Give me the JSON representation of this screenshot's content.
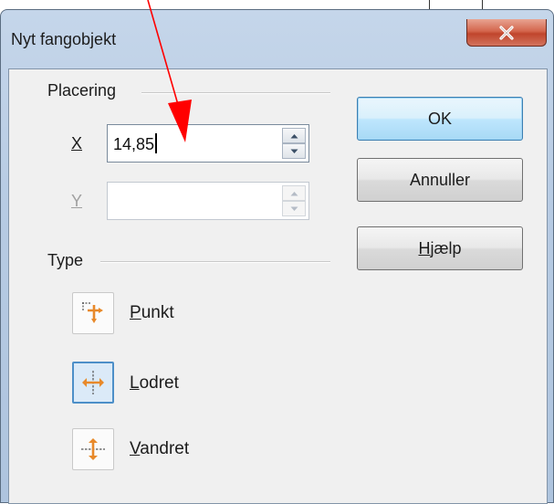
{
  "window": {
    "title": "Nyt fangobjekt",
    "close_icon": "close-x-icon"
  },
  "placement": {
    "group_label": "Placering",
    "x": {
      "label_accel": "X",
      "value": "14,85",
      "enabled": true
    },
    "y": {
      "label_accel": "Y",
      "value": "",
      "enabled": false
    }
  },
  "buttons": {
    "ok": "OK",
    "cancel": "Annuller",
    "help_accel": "H",
    "help_rest": "jælp"
  },
  "type": {
    "group_label": "Type",
    "options": [
      {
        "accel": "P",
        "rest": "unkt",
        "icon": "point-snap-icon",
        "selected": false
      },
      {
        "accel": "L",
        "rest": "odret",
        "icon": "vertical-snap-icon",
        "selected": true
      },
      {
        "accel": "V",
        "rest": "andret",
        "icon": "horizontal-snap-icon",
        "selected": false
      }
    ]
  },
  "colors": {
    "annotation_arrow": "#ff0000",
    "default_button_border": "#3c7fb1",
    "icon_orange": "#e8892a"
  },
  "annotation": {
    "icon": "red-arrow-annotation"
  }
}
